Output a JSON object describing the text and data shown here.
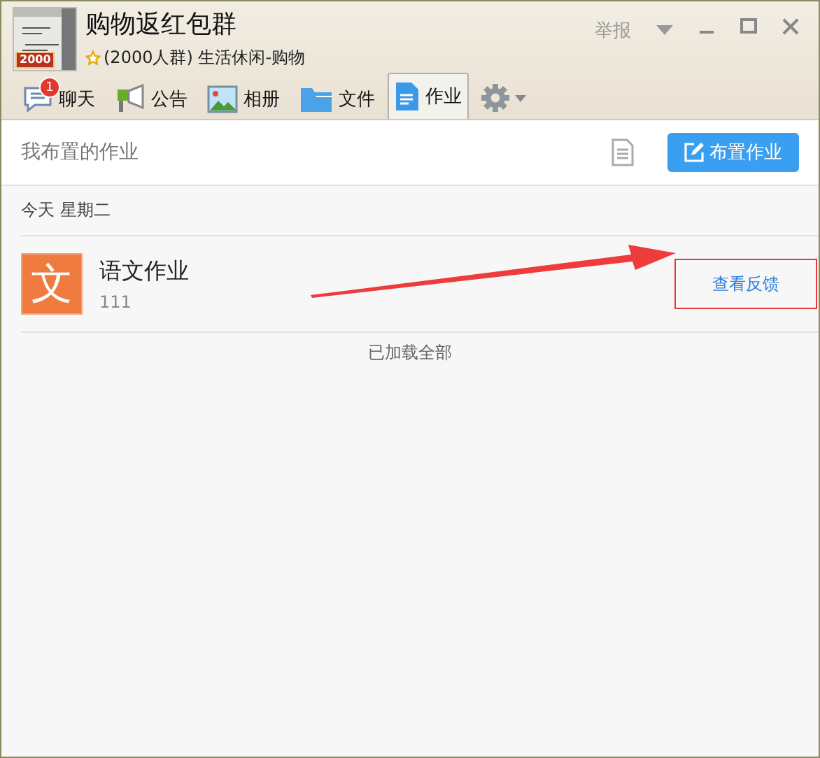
{
  "group": {
    "name": "购物返红包群",
    "avatar_badge": "2000",
    "info": "(2000人群) 生活休闲-购物"
  },
  "title_actions": {
    "report": "举报"
  },
  "tabs": [
    {
      "label": "聊天",
      "kind": "chat",
      "badge": "1",
      "selected": false
    },
    {
      "label": "公告",
      "kind": "notice",
      "selected": false
    },
    {
      "label": "相册",
      "kind": "album",
      "selected": false
    },
    {
      "label": "文件",
      "kind": "file",
      "selected": false
    },
    {
      "label": "作业",
      "kind": "homework",
      "selected": true
    }
  ],
  "toolbar": {
    "title": "我布置的作业",
    "assign_button": "布置作业"
  },
  "sections": [
    {
      "date": "今天 星期二",
      "items": [
        {
          "icon_char": "文",
          "title": "语文作业",
          "subtitle": "111",
          "action": "查看反馈",
          "highlighted": true
        }
      ]
    }
  ],
  "footer": "已加载全部"
}
